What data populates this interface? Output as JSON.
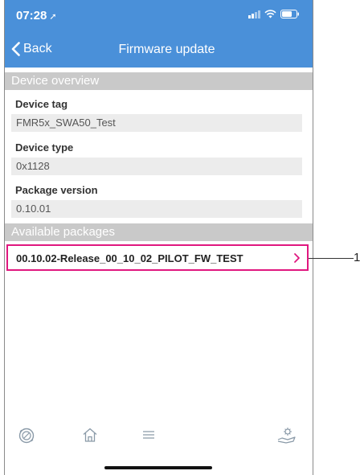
{
  "status": {
    "time": "07:28",
    "location_glyph": "➚"
  },
  "navbar": {
    "back_label": "Back",
    "title": "Firmware update"
  },
  "device_overview": {
    "header": "Device overview",
    "fields": [
      {
        "label": "Device tag",
        "value": "FMR5x_SWA50_Test"
      },
      {
        "label": "Device type",
        "value": "0x1128"
      },
      {
        "label": "Package version",
        "value": "0.10.01"
      }
    ]
  },
  "available_packages": {
    "header": "Available packages",
    "items": [
      {
        "label": "00.10.02-Release_00_10_02_PILOT_FW_TEST"
      }
    ]
  },
  "tabbar": {
    "icons": [
      "device-icon",
      "home-icon",
      "menu-icon",
      "hand-gear-icon"
    ]
  },
  "callout": {
    "number": "1"
  },
  "colors": {
    "accent": "#4a90d9",
    "section_header": "#c9c9c9",
    "highlight": "#e0177f"
  }
}
